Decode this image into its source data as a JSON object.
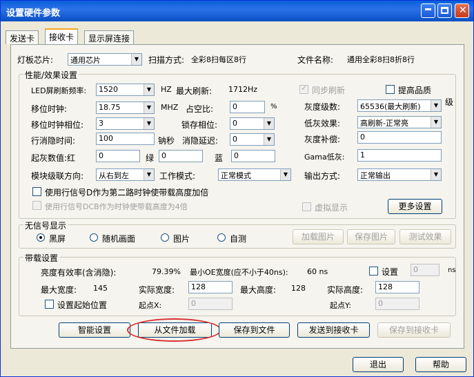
{
  "window": {
    "title": "设置硬件参数"
  },
  "tabs": [
    "发送卡",
    "接收卡",
    "显示屏连接"
  ],
  "top": {
    "chip_label": "灯板芯片:",
    "chip_value": "通用芯片",
    "scan_label": "扫描方式:",
    "scan_value": "全彩8扫每区8行",
    "file_label": "文件名称:",
    "file_value": "通用全彩8扫8折8行"
  },
  "perf": {
    "title": "性能/效果设置",
    "refresh_label": "LED屏刷新频率:",
    "refresh_value": "1520",
    "hz": "HZ",
    "max_refresh_label": "最大刷新:",
    "max_refresh_value": "1712Hz",
    "shift_clock_label": "移位时钟:",
    "shift_clock_value": "18.75",
    "mhz": "MHZ",
    "duty_label": "占空比:",
    "duty_value": "0",
    "pct": "%",
    "shift_phase_label": "移位时钟相位:",
    "shift_phase_value": "3",
    "latch_phase_label": "锁存相位:",
    "latch_phase_value": "0",
    "blank_label": "行消隐时间:",
    "blank_value": "100",
    "ns_label": "钠秒",
    "blank_delay_label": "消隐延迟:",
    "blank_delay_value": "0",
    "start_gray_label": "起灰数值:红",
    "red_value": "0",
    "green_label": "绿",
    "green_value": "0",
    "blue_label": "蓝",
    "blue_value": "0",
    "cascade_label": "模块级联方向:",
    "cascade_value": "从右到左",
    "work_mode_label": "工作模式:",
    "work_mode_value": "正常模式",
    "row_signal_label": "使用行信号D作为第二路时钟使带载高度加倍",
    "row_signal_e_label": "使用行信号DCB作为时钟使带载高度为4倍",
    "sync_label": "同步刷新",
    "quality_label": "提高品质",
    "gray_levels_label": "灰度级数:",
    "gray_levels_value": "65536(最大刷新)",
    "level_suffix": "级",
    "low_gray_label": "低灰效果:",
    "low_gray_value": "高刷新-正常亮",
    "gray_comp_label": "灰度补偿:",
    "gray_comp_value": "0",
    "gamma_label": "Gama低灰:",
    "gamma_value": "1",
    "output_label": "输出方式:",
    "output_value": "正常输出",
    "virtual_label": "虚拟显示",
    "more_button": "更多设置"
  },
  "nosignal": {
    "title": "无信号显示",
    "options": [
      "黑屏",
      "随机画面",
      "图片",
      "自测"
    ],
    "load_pic": "加载图片",
    "save_pic": "保存图片",
    "test_effect": "测试效果"
  },
  "load": {
    "title": "带载设置",
    "efficiency_label": "亮度有效率(含消隐):",
    "efficiency_value": "79.39%",
    "min_oe_label": "最小OE宽度(应不小于40ns):",
    "min_oe_value": "60 ns",
    "set_label": "设置",
    "set_value": "0",
    "ns": "ns",
    "max_width_label": "最大宽度:",
    "max_width_value": "145",
    "actual_width_label": "实际宽度:",
    "actual_width_value": "128",
    "max_height_label": "最大高度:",
    "max_height_value": "128",
    "actual_height_label": "实际高度:",
    "actual_height_value": "128",
    "start_pos_label": "设置起始位置",
    "start_x_label": "起点X:",
    "start_x_value": "0",
    "start_y_label": "起点Y:",
    "start_y_value": "0"
  },
  "actions": {
    "smart": "智能设置",
    "load_file": "从文件加载",
    "save_file": "保存到文件",
    "send": "发送到接收卡",
    "save_recv": "保存到接收卡"
  },
  "footer": {
    "exit": "退出",
    "help": "帮助"
  }
}
